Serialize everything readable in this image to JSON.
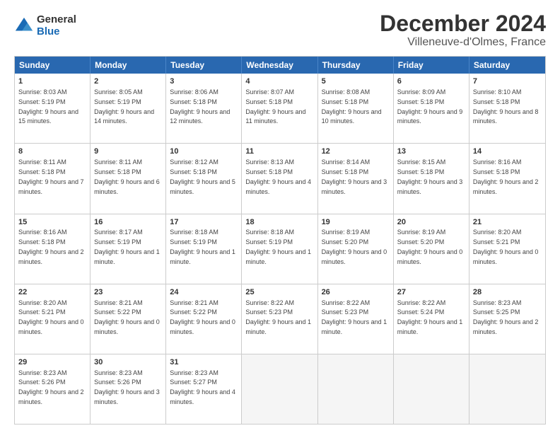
{
  "logo": {
    "general": "General",
    "blue": "Blue"
  },
  "title": "December 2024",
  "location": "Villeneuve-d'Olmes, France",
  "header_days": [
    "Sunday",
    "Monday",
    "Tuesday",
    "Wednesday",
    "Thursday",
    "Friday",
    "Saturday"
  ],
  "weeks": [
    [
      {
        "day": "1",
        "sunrise": "Sunrise: 8:03 AM",
        "sunset": "Sunset: 5:19 PM",
        "daylight": "Daylight: 9 hours and 15 minutes."
      },
      {
        "day": "2",
        "sunrise": "Sunrise: 8:05 AM",
        "sunset": "Sunset: 5:19 PM",
        "daylight": "Daylight: 9 hours and 14 minutes."
      },
      {
        "day": "3",
        "sunrise": "Sunrise: 8:06 AM",
        "sunset": "Sunset: 5:18 PM",
        "daylight": "Daylight: 9 hours and 12 minutes."
      },
      {
        "day": "4",
        "sunrise": "Sunrise: 8:07 AM",
        "sunset": "Sunset: 5:18 PM",
        "daylight": "Daylight: 9 hours and 11 minutes."
      },
      {
        "day": "5",
        "sunrise": "Sunrise: 8:08 AM",
        "sunset": "Sunset: 5:18 PM",
        "daylight": "Daylight: 9 hours and 10 minutes."
      },
      {
        "day": "6",
        "sunrise": "Sunrise: 8:09 AM",
        "sunset": "Sunset: 5:18 PM",
        "daylight": "Daylight: 9 hours and 9 minutes."
      },
      {
        "day": "7",
        "sunrise": "Sunrise: 8:10 AM",
        "sunset": "Sunset: 5:18 PM",
        "daylight": "Daylight: 9 hours and 8 minutes."
      }
    ],
    [
      {
        "day": "8",
        "sunrise": "Sunrise: 8:11 AM",
        "sunset": "Sunset: 5:18 PM",
        "daylight": "Daylight: 9 hours and 7 minutes."
      },
      {
        "day": "9",
        "sunrise": "Sunrise: 8:11 AM",
        "sunset": "Sunset: 5:18 PM",
        "daylight": "Daylight: 9 hours and 6 minutes."
      },
      {
        "day": "10",
        "sunrise": "Sunrise: 8:12 AM",
        "sunset": "Sunset: 5:18 PM",
        "daylight": "Daylight: 9 hours and 5 minutes."
      },
      {
        "day": "11",
        "sunrise": "Sunrise: 8:13 AM",
        "sunset": "Sunset: 5:18 PM",
        "daylight": "Daylight: 9 hours and 4 minutes."
      },
      {
        "day": "12",
        "sunrise": "Sunrise: 8:14 AM",
        "sunset": "Sunset: 5:18 PM",
        "daylight": "Daylight: 9 hours and 3 minutes."
      },
      {
        "day": "13",
        "sunrise": "Sunrise: 8:15 AM",
        "sunset": "Sunset: 5:18 PM",
        "daylight": "Daylight: 9 hours and 3 minutes."
      },
      {
        "day": "14",
        "sunrise": "Sunrise: 8:16 AM",
        "sunset": "Sunset: 5:18 PM",
        "daylight": "Daylight: 9 hours and 2 minutes."
      }
    ],
    [
      {
        "day": "15",
        "sunrise": "Sunrise: 8:16 AM",
        "sunset": "Sunset: 5:18 PM",
        "daylight": "Daylight: 9 hours and 2 minutes."
      },
      {
        "day": "16",
        "sunrise": "Sunrise: 8:17 AM",
        "sunset": "Sunset: 5:19 PM",
        "daylight": "Daylight: 9 hours and 1 minute."
      },
      {
        "day": "17",
        "sunrise": "Sunrise: 8:18 AM",
        "sunset": "Sunset: 5:19 PM",
        "daylight": "Daylight: 9 hours and 1 minute."
      },
      {
        "day": "18",
        "sunrise": "Sunrise: 8:18 AM",
        "sunset": "Sunset: 5:19 PM",
        "daylight": "Daylight: 9 hours and 1 minute."
      },
      {
        "day": "19",
        "sunrise": "Sunrise: 8:19 AM",
        "sunset": "Sunset: 5:20 PM",
        "daylight": "Daylight: 9 hours and 0 minutes."
      },
      {
        "day": "20",
        "sunrise": "Sunrise: 8:19 AM",
        "sunset": "Sunset: 5:20 PM",
        "daylight": "Daylight: 9 hours and 0 minutes."
      },
      {
        "day": "21",
        "sunrise": "Sunrise: 8:20 AM",
        "sunset": "Sunset: 5:21 PM",
        "daylight": "Daylight: 9 hours and 0 minutes."
      }
    ],
    [
      {
        "day": "22",
        "sunrise": "Sunrise: 8:20 AM",
        "sunset": "Sunset: 5:21 PM",
        "daylight": "Daylight: 9 hours and 0 minutes."
      },
      {
        "day": "23",
        "sunrise": "Sunrise: 8:21 AM",
        "sunset": "Sunset: 5:22 PM",
        "daylight": "Daylight: 9 hours and 0 minutes."
      },
      {
        "day": "24",
        "sunrise": "Sunrise: 8:21 AM",
        "sunset": "Sunset: 5:22 PM",
        "daylight": "Daylight: 9 hours and 0 minutes."
      },
      {
        "day": "25",
        "sunrise": "Sunrise: 8:22 AM",
        "sunset": "Sunset: 5:23 PM",
        "daylight": "Daylight: 9 hours and 1 minute."
      },
      {
        "day": "26",
        "sunrise": "Sunrise: 8:22 AM",
        "sunset": "Sunset: 5:23 PM",
        "daylight": "Daylight: 9 hours and 1 minute."
      },
      {
        "day": "27",
        "sunrise": "Sunrise: 8:22 AM",
        "sunset": "Sunset: 5:24 PM",
        "daylight": "Daylight: 9 hours and 1 minute."
      },
      {
        "day": "28",
        "sunrise": "Sunrise: 8:23 AM",
        "sunset": "Sunset: 5:25 PM",
        "daylight": "Daylight: 9 hours and 2 minutes."
      }
    ],
    [
      {
        "day": "29",
        "sunrise": "Sunrise: 8:23 AM",
        "sunset": "Sunset: 5:26 PM",
        "daylight": "Daylight: 9 hours and 2 minutes."
      },
      {
        "day": "30",
        "sunrise": "Sunrise: 8:23 AM",
        "sunset": "Sunset: 5:26 PM",
        "daylight": "Daylight: 9 hours and 3 minutes."
      },
      {
        "day": "31",
        "sunrise": "Sunrise: 8:23 AM",
        "sunset": "Sunset: 5:27 PM",
        "daylight": "Daylight: 9 hours and 4 minutes."
      },
      null,
      null,
      null,
      null
    ]
  ]
}
